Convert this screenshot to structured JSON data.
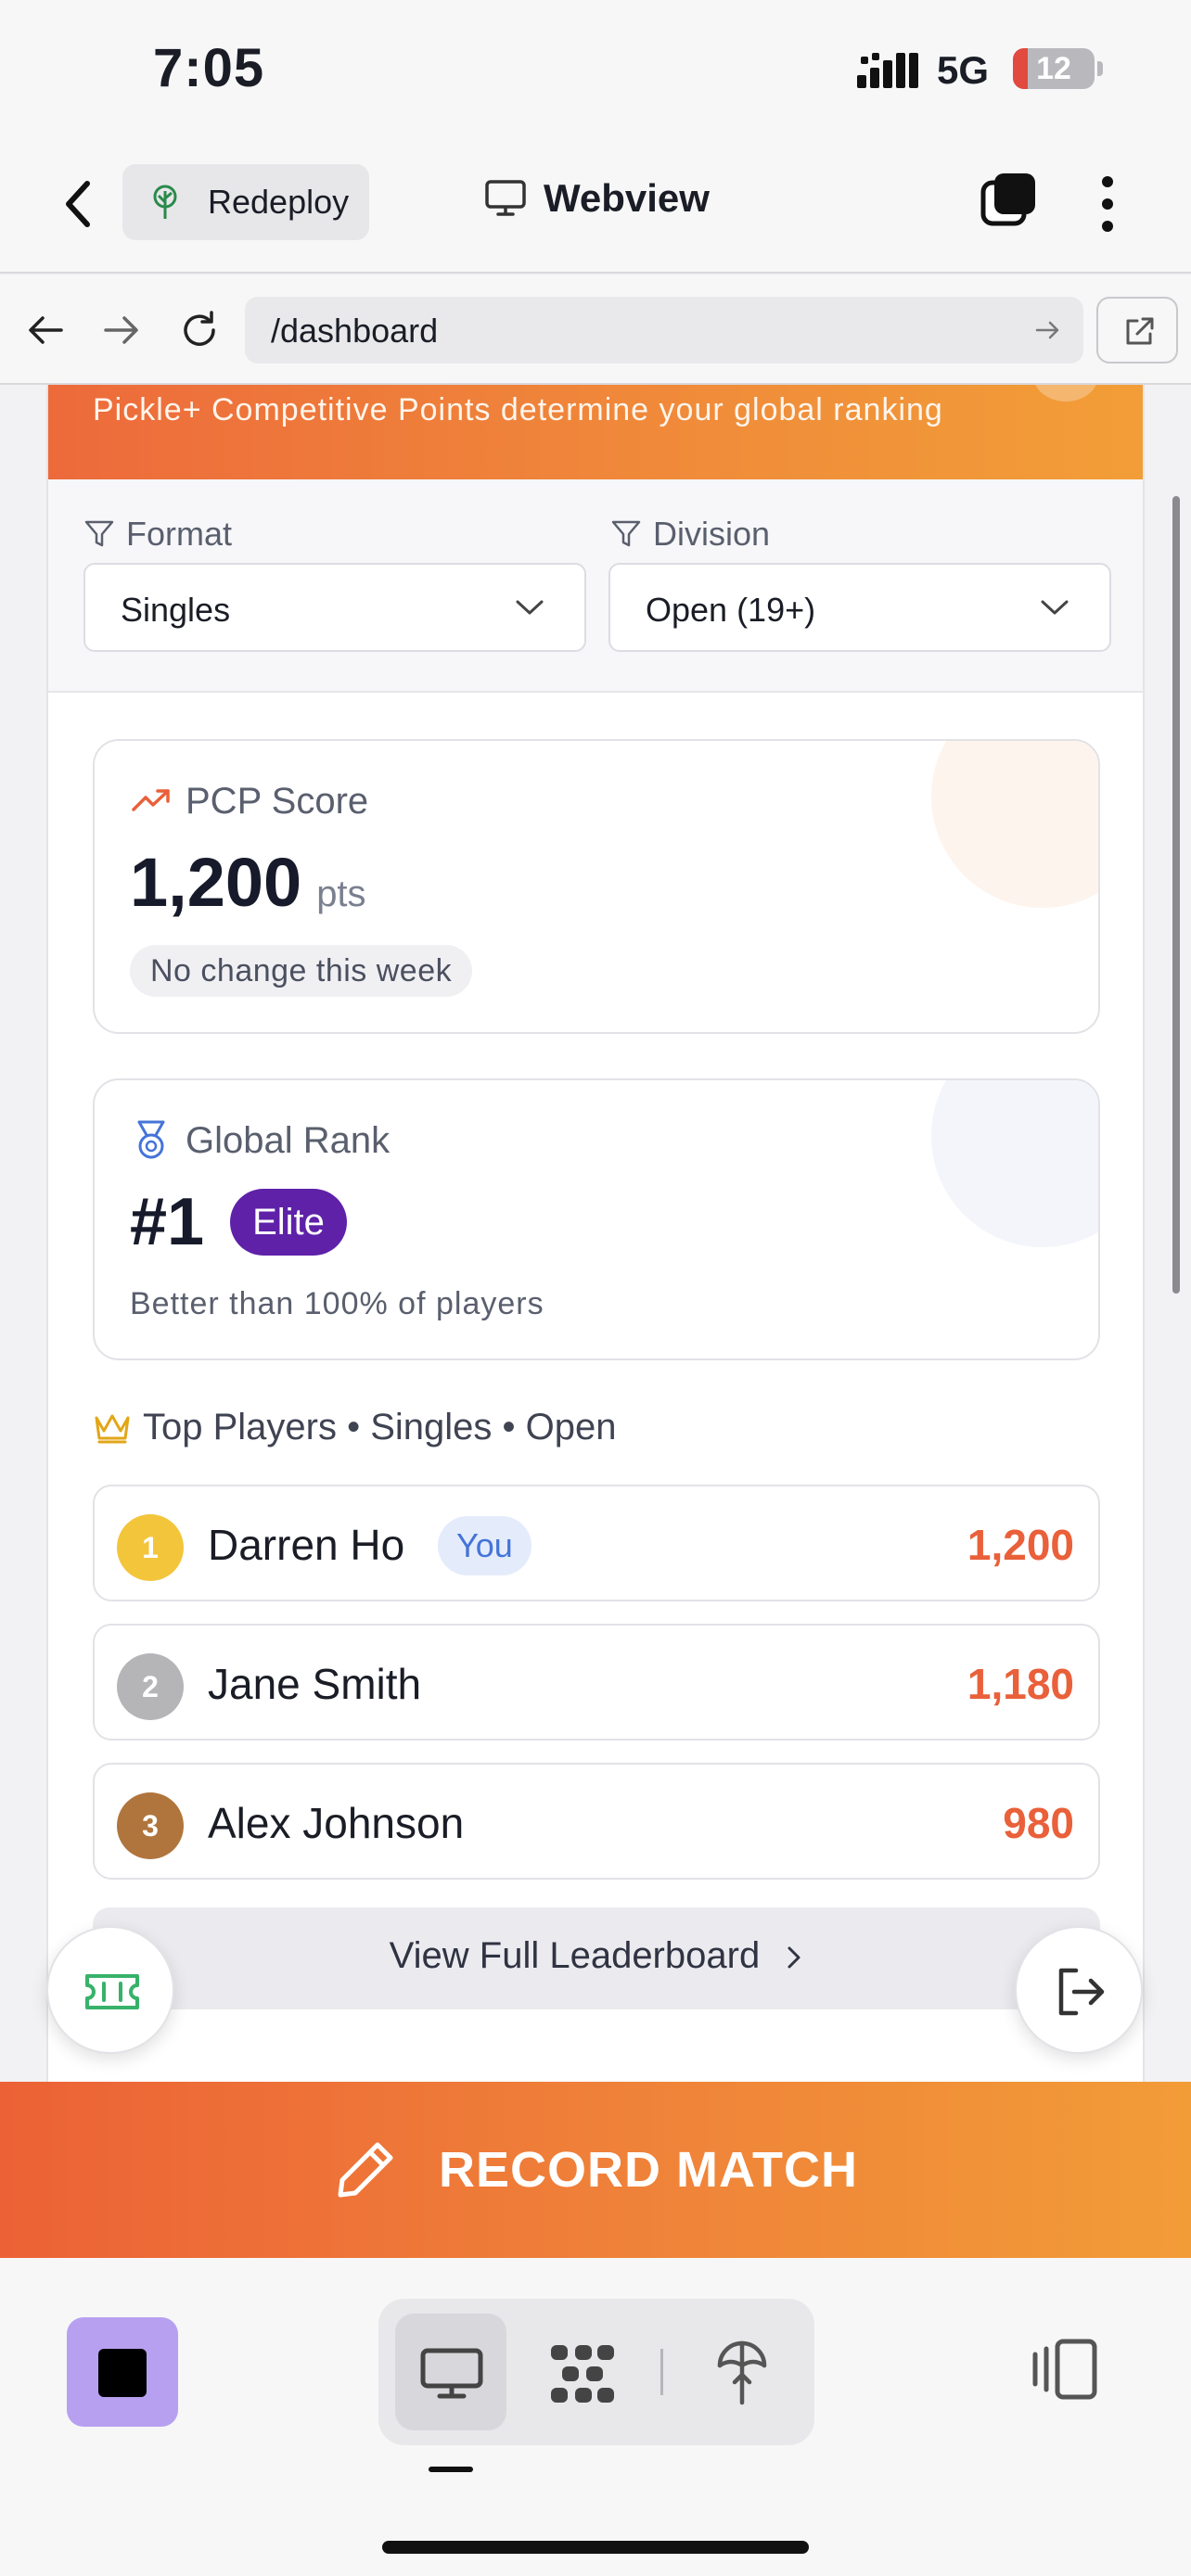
{
  "status_bar": {
    "time": "7:05",
    "network": "5G",
    "battery": "12"
  },
  "app_header": {
    "redeploy_label": "Redeploy",
    "title": "Webview"
  },
  "url_bar": {
    "url": "/dashboard"
  },
  "banner": {
    "text": "Pickle+ Competitive Points determine your global ranking"
  },
  "filters": {
    "format_label": "Format",
    "format_value": "Singles",
    "division_label": "Division",
    "division_value": "Open (19+)"
  },
  "pcp": {
    "label": "PCP Score",
    "value": "1,200",
    "unit": "pts",
    "change": "No change this week"
  },
  "global_rank": {
    "label": "Global Rank",
    "value": "#1",
    "tier": "Elite",
    "percentile": "Better than 100% of players"
  },
  "top_players": {
    "title": "Top Players • Singles • Open",
    "you_label": "You",
    "players": [
      {
        "rank": "1",
        "name": "Darren Ho",
        "points": "1,200",
        "is_you": true
      },
      {
        "rank": "2",
        "name": "Jane Smith",
        "points": "1,180",
        "is_you": false
      },
      {
        "rank": "3",
        "name": "Alex Johnson",
        "points": "980",
        "is_you": false
      }
    ],
    "view_full": "View Full Leaderboard"
  },
  "record_match": {
    "label": "RECORD MATCH"
  },
  "colors": {
    "accent_orange": "#ed6a3b",
    "elite_purple": "#5e21a8",
    "points_orange": "#e9603a",
    "gold": "#f3c53b",
    "silver": "#b5b5b8",
    "bronze": "#b0753d",
    "you_blue": "#4574d8"
  },
  "icons": [
    "back-chevron-icon",
    "redeploy-tree-icon",
    "monitor-icon",
    "tabs-icon",
    "more-vertical-icon",
    "arrow-left-icon",
    "arrow-right-icon",
    "reload-icon",
    "go-arrow-icon",
    "external-link-icon",
    "filter-icon",
    "trending-up-icon",
    "medal-icon",
    "crown-icon",
    "ticket-icon",
    "logout-icon",
    "pencil-icon",
    "stop-icon",
    "grid-icon",
    "antenna-icon",
    "side-panel-icon"
  ]
}
